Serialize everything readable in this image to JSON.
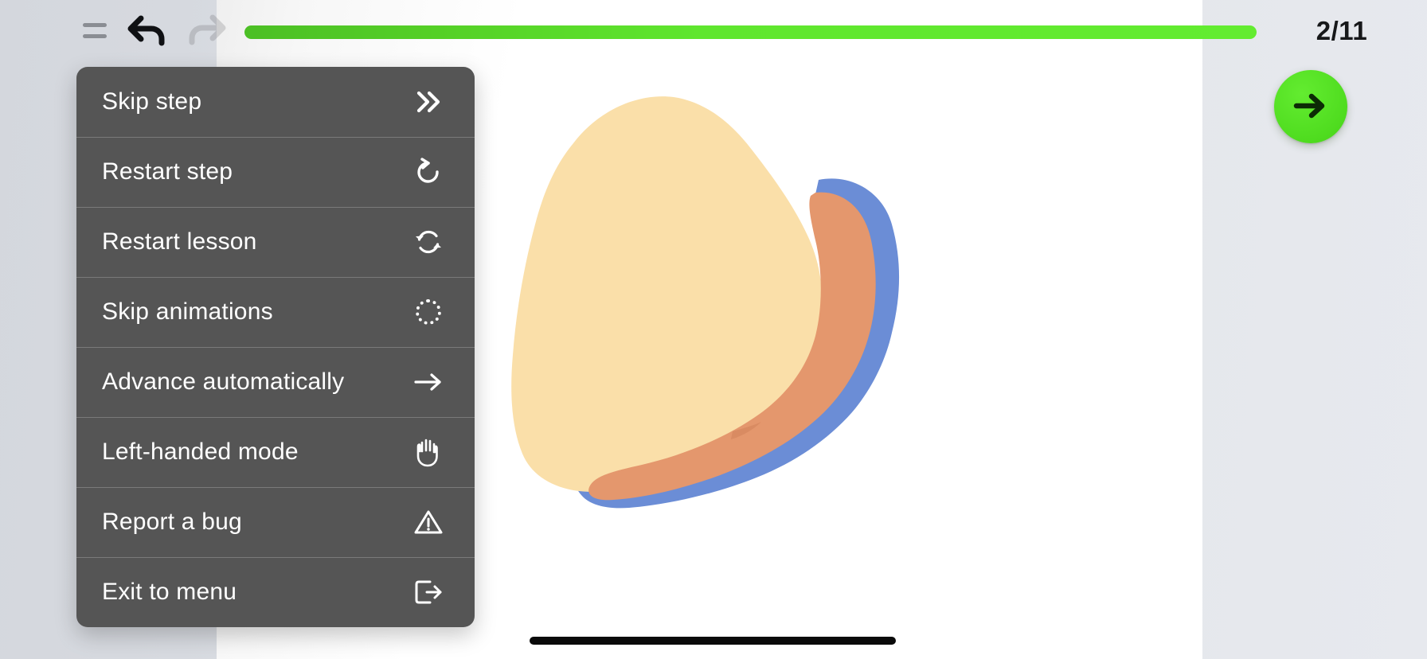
{
  "app": {
    "type": "lesson-player",
    "background_color": "#d6d9df",
    "canvas_color": "#ffffff"
  },
  "toolbar": {
    "menu_toggle": {
      "name": "menu-toggle",
      "icon": "equals-icon"
    },
    "undo": {
      "name": "undo",
      "icon": "undo-arrow-icon",
      "enabled": true
    },
    "redo": {
      "name": "redo",
      "icon": "redo-arrow-icon",
      "enabled": false
    }
  },
  "progress": {
    "value": 2,
    "total": 11,
    "counter_label": "2/11",
    "percent": 100,
    "fill_color": "#5fe62e",
    "track_color": "#ffffff"
  },
  "next_button": {
    "label": "",
    "icon": "arrow-right-icon",
    "color": "#52de20",
    "arrow_color": "#0c2b05"
  },
  "options_menu": {
    "visible": true,
    "background_color": "#555555",
    "items": [
      {
        "label": "Skip step",
        "icon": "double-chevron-right-icon"
      },
      {
        "label": "Restart step",
        "icon": "rotate-counterclockwise-icon"
      },
      {
        "label": "Restart lesson",
        "icon": "refresh-cycle-icon"
      },
      {
        "label": "Skip animations",
        "icon": "dotted-circle-icon"
      },
      {
        "label": "Advance automatically",
        "icon": "arrow-right-icon"
      },
      {
        "label": "Left-handed mode",
        "icon": "hand-icon"
      },
      {
        "label": "Report a bug",
        "icon": "warning-triangle-icon"
      },
      {
        "label": "Exit to menu",
        "icon": "exit-door-icon"
      }
    ]
  },
  "illustration": {
    "name": "hand-drawing",
    "description": "Hand with thumb illustration",
    "colors": {
      "palm": "#fadfa9",
      "thumb": "#e4976d",
      "outline": "#6b8dd6"
    }
  },
  "home_indicator": {
    "color": "#0a0a0a"
  }
}
